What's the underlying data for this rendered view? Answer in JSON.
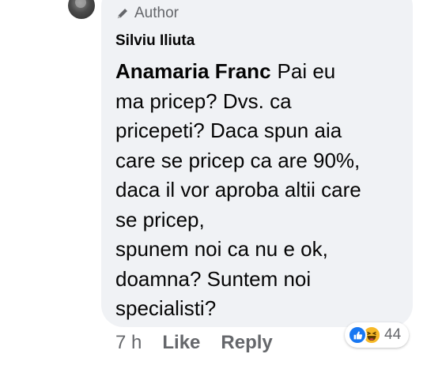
{
  "comment": {
    "author_badge": "Author",
    "author_name": "Silviu Iliuta",
    "mention": "Anamaria Franc",
    "text": "Pai eu\nma pricep? Dvs. ca\npricepeti? Daca spun aia\ncare se pricep ca are 90%,\ndaca il vor aproba altii care\nse pricep,\nspunem noi ca nu e ok,\ndoamna? Suntem noi\nspecialisti?"
  },
  "actions": {
    "time": "7 h",
    "like_label": "Like",
    "reply_label": "Reply"
  },
  "reactions": {
    "icons": [
      "like-icon",
      "haha-icon"
    ],
    "count": "44"
  },
  "colors": {
    "bubble": "#f0f2f5",
    "secondary_text": "#65676b",
    "like_blue": "#1877f2",
    "haha_yellow": "#f7b928"
  }
}
